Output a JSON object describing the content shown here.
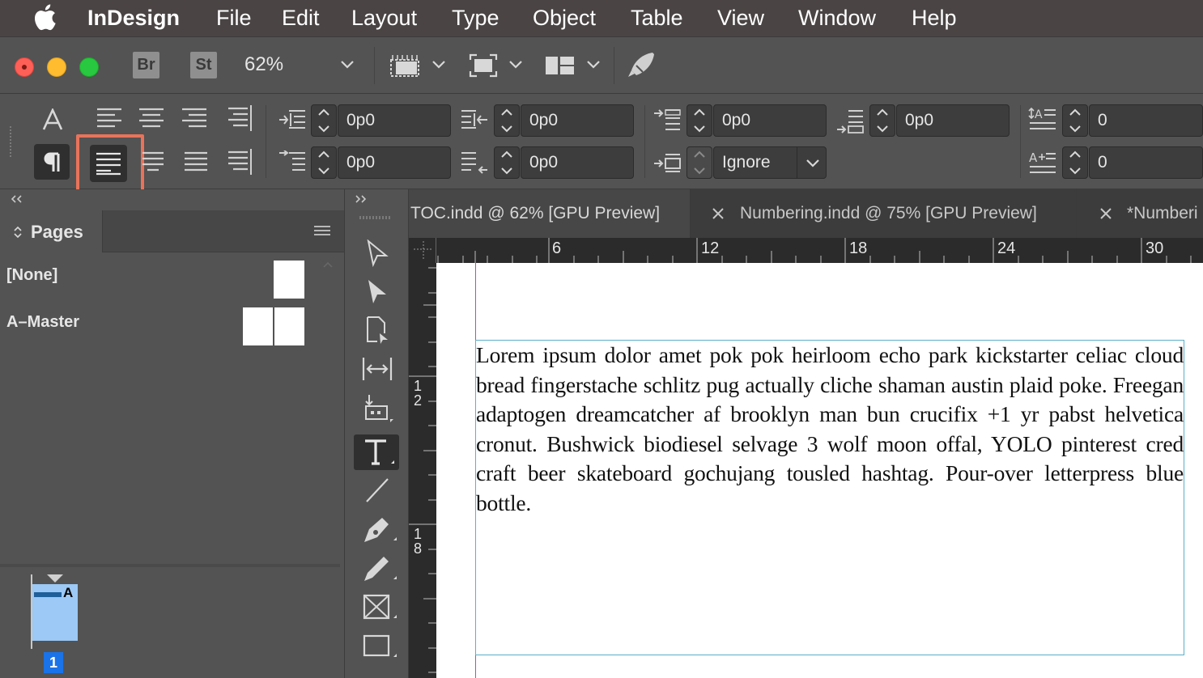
{
  "menubar": {
    "apple_icon": "apple-logo-icon",
    "app_name": "InDesign",
    "items": [
      "File",
      "Edit",
      "Layout",
      "Type",
      "Object",
      "Table",
      "View",
      "Window",
      "Help"
    ]
  },
  "topbar": {
    "bridge_label": "Br",
    "stock_label": "St",
    "zoom_value": "62%"
  },
  "paragraph_panel": {
    "left_indent": "0p0",
    "right_indent": "0p0",
    "first_line_indent": "0p0",
    "last_line_indent": "0p0",
    "space_before": "0p0",
    "space_after": "0p0",
    "align_to_grid": "Ignore",
    "drop_cap_lines": "0",
    "drop_cap_chars": "0"
  },
  "pages_panel": {
    "title": "Pages",
    "masters": [
      "[None]",
      "A–Master"
    ],
    "page_master_letter": "A",
    "page_number": "1"
  },
  "doc_tabs": [
    "TOC.indd @ 62% [GPU Preview]",
    "Numbering.indd @ 75% [GPU Preview]",
    "*Numberi"
  ],
  "ruler": {
    "h_labels": [
      "6",
      "12",
      "18",
      "24",
      "30"
    ],
    "v_labels": [
      "1\n2",
      "1\n8"
    ]
  },
  "document": {
    "body_text": "Lorem ipsum dolor amet pok pok heirloom echo park kickstarter celiac cloud bread fingerstache schlitz pug actually cliche shaman austin plaid poke. Freegan adaptogen dreamcatcher af brooklyn man bun crucifix +1 yr pabst helvetica cronut. Bushwick biodiesel selvage 3 wolf moon offal, YOLO pinterest cred craft beer skateboard gochujang tousled hashtag. Pour-over letterpress blue bottle."
  },
  "colors": {
    "highlight": "#e8735a",
    "accent_blue": "#1a73e8",
    "page_thumb": "#9cc9f5"
  }
}
